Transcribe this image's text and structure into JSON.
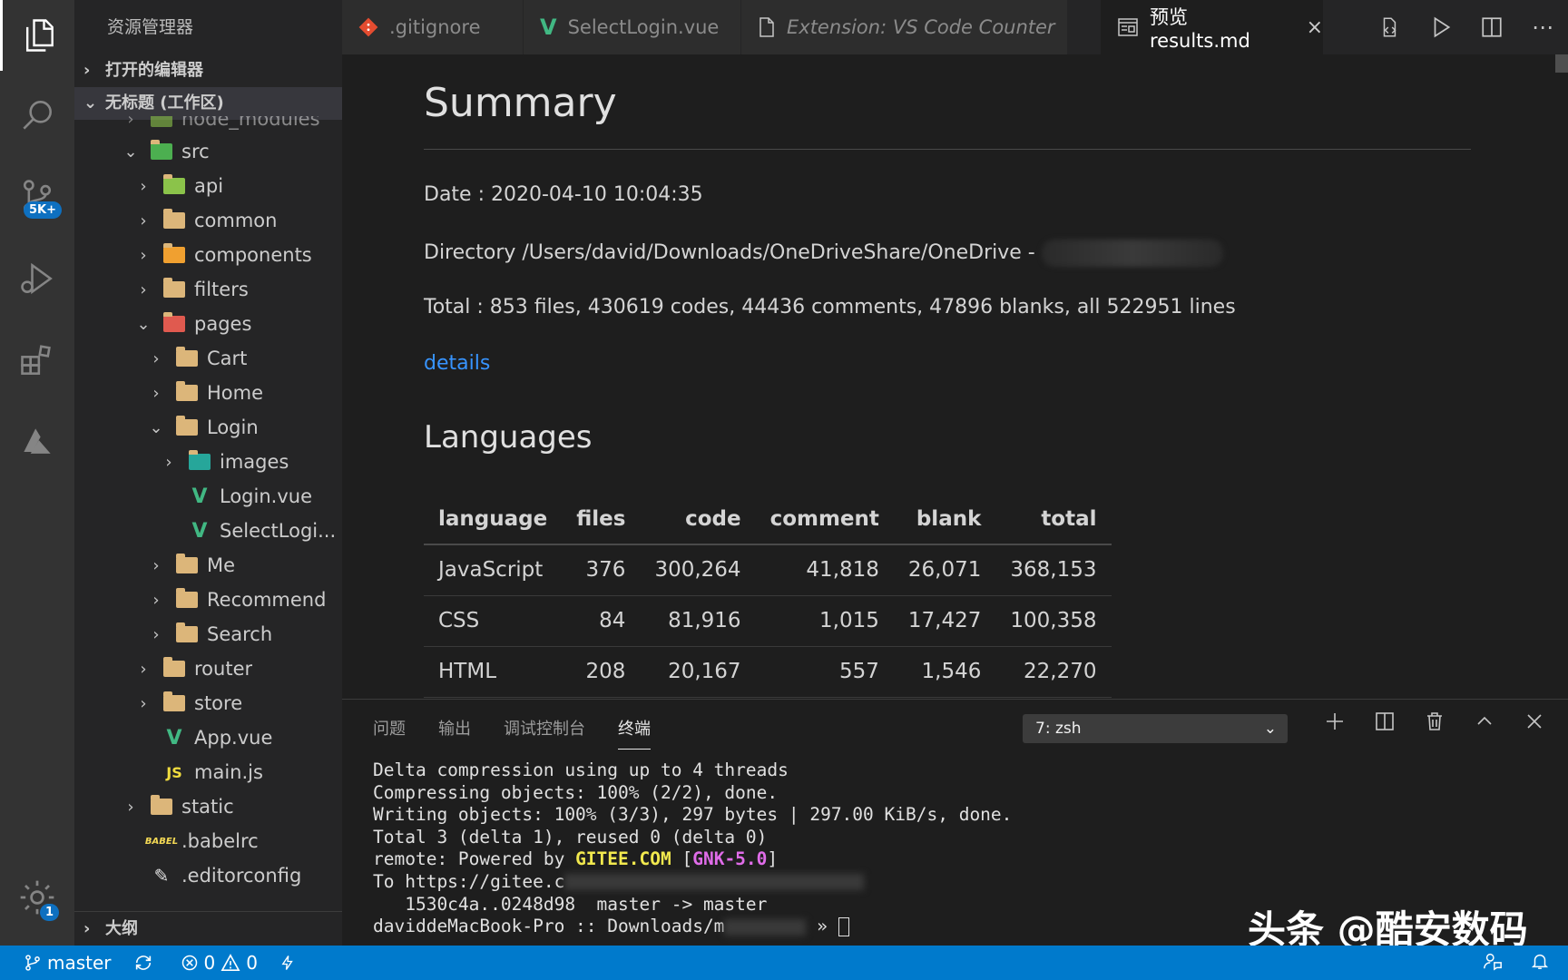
{
  "activity_bar": {
    "scm_badge": "5K+",
    "settings_badge": "1"
  },
  "sidebar": {
    "title": "资源管理器",
    "open_editors": "打开的编辑器",
    "workspace": "无标题 (工作区)",
    "outline": "大纲",
    "tree": [
      {
        "label": "node_modules"
      },
      {
        "label": "src"
      },
      {
        "label": "api"
      },
      {
        "label": "common"
      },
      {
        "label": "components"
      },
      {
        "label": "filters"
      },
      {
        "label": "pages"
      },
      {
        "label": "Cart"
      },
      {
        "label": "Home"
      },
      {
        "label": "Login"
      },
      {
        "label": "images"
      },
      {
        "label": "Login.vue"
      },
      {
        "label": "SelectLogi..."
      },
      {
        "label": "Me"
      },
      {
        "label": "Recommend"
      },
      {
        "label": "Search"
      },
      {
        "label": "router"
      },
      {
        "label": "store"
      },
      {
        "label": "App.vue"
      },
      {
        "label": "main.js"
      },
      {
        "label": "static"
      },
      {
        "label": ".babelrc"
      },
      {
        "label": ".editorconfig"
      }
    ]
  },
  "tabs": [
    {
      "label": ".gitignore"
    },
    {
      "label": "SelectLogin.vue"
    },
    {
      "label": "Extension: VS Code Counter"
    },
    {
      "label": "预览 results.md"
    }
  ],
  "preview": {
    "title": "Summary",
    "date": "Date : 2020-04-10 10:04:35",
    "directory": "Directory /Users/david/Downloads/OneDriveShare/OneDrive -",
    "total": "Total : 853 files, 430619 codes, 44436 comments, 47896 blanks, all 522951 lines",
    "details_link": "details",
    "languages_heading": "Languages",
    "table": {
      "headers": [
        "language",
        "files",
        "code",
        "comment",
        "blank",
        "total"
      ],
      "rows": [
        [
          "JavaScript",
          "376",
          "300,264",
          "41,818",
          "26,071",
          "368,153"
        ],
        [
          "CSS",
          "84",
          "81,916",
          "1,015",
          "17,427",
          "100,358"
        ],
        [
          "HTML",
          "208",
          "20,167",
          "557",
          "1,546",
          "22,270"
        ]
      ]
    }
  },
  "panel": {
    "tabs": [
      "问题",
      "输出",
      "调试控制台",
      "终端"
    ],
    "terminal_select": "7: zsh",
    "lines": {
      "l1": "Delta compression using up to 4 threads",
      "l2": "Compressing objects: 100% (2/2), done.",
      "l3": "Writing objects: 100% (3/3), 297 bytes | 297.00 KiB/s, done.",
      "l4": "Total 3 (delta 1), reused 0 (delta 0)",
      "l5_prefix": "remote: Powered by ",
      "l5_gitee": "GITEE.COM",
      "l5_open": " [",
      "l5_gnk": "GNK-5.0",
      "l5_close": "]",
      "l6_prefix": "To https://gitee.c",
      "l7": "   1530c4a..0248d98  master -> master",
      "l8_prefix": "daviddeMacBook-Pro :: Downloads/m",
      "l8_suffix": " » "
    }
  },
  "watermark": "头条 @酷安数码",
  "status_bar": {
    "branch": "master",
    "errors": "0",
    "warnings": "0"
  }
}
